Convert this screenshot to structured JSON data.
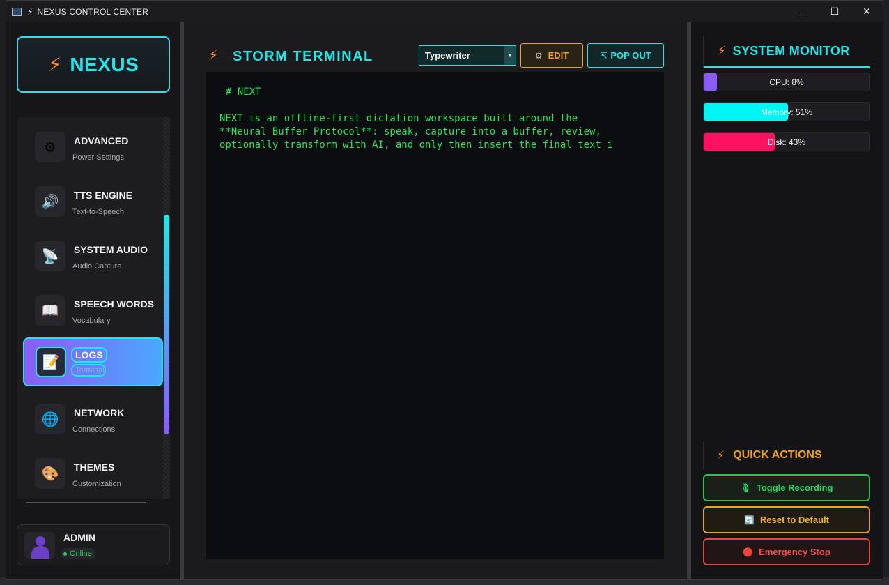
{
  "window": {
    "title": "NEXUS CONTROL CENTER",
    "minimize": "—",
    "maximize": "☐",
    "close": "✕"
  },
  "sidebar": {
    "brand": "NEXUS",
    "items": [
      {
        "title": "ADVANCED",
        "subtitle": "Power Settings",
        "icon": "⚙",
        "icon_name": "gear-icon"
      },
      {
        "title": "TTS ENGINE",
        "subtitle": "Text-to-Speech",
        "icon": "🔊",
        "icon_name": "speaker-icon"
      },
      {
        "title": "SYSTEM AUDIO",
        "subtitle": "Audio Capture",
        "icon": "📡",
        "icon_name": "satellite-icon"
      },
      {
        "title": "SPEECH WORDS",
        "subtitle": "Vocabulary",
        "icon": "📖",
        "icon_name": "book-icon"
      },
      {
        "title": "LOGS",
        "subtitle": "Terminal",
        "icon": "📝",
        "icon_name": "memo-icon",
        "active": true
      },
      {
        "title": "NETWORK",
        "subtitle": "Connections",
        "icon": "🌐",
        "icon_name": "globe-icon"
      },
      {
        "title": "THEMES",
        "subtitle": "Customization",
        "icon": "🎨",
        "icon_name": "palette-icon"
      }
    ],
    "user": {
      "name": "ADMIN",
      "status": "Online"
    }
  },
  "terminal": {
    "title": "STORM TERMINAL",
    "mode": "Typewriter",
    "edit_label": "EDIT",
    "popout_label": "POP OUT",
    "heading": "# NEXT",
    "lines": [
      "NEXT is an offline-first dictation workspace built around the",
      "**Neural Buffer Protocol**: speak, capture into a buffer, review,",
      "optionally transform with AI, and only then insert the final text i"
    ]
  },
  "monitor": {
    "title": "SYSTEM MONITOR",
    "cpu": {
      "label": "CPU: 8%",
      "percent": 8,
      "color": "#8a5cf6"
    },
    "memory": {
      "label": "Memory: 51%",
      "percent": 51,
      "color": "#00f5f5"
    },
    "disk": {
      "label": "Disk: 43%",
      "percent": 43,
      "color": "#ff1060"
    }
  },
  "quick_actions": {
    "title": "QUICK ACTIONS",
    "toggle_recording": "Toggle Recording",
    "reset_default": "Reset to Default",
    "emergency_stop": "Emergency Stop"
  }
}
